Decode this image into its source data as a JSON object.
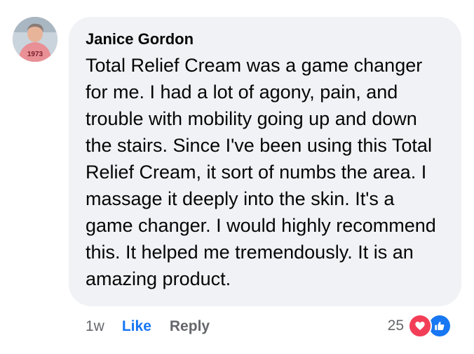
{
  "comment": {
    "author": "Janice Gordon",
    "avatar_text": "1973",
    "text": "Total Relief Cream was a game changer for me. I had a lot of agony, pain, and trouble with mobility going up and down the stairs. Since I've been using this Total Relief Cream, it sort of numbs the area. I massage it deeply into the skin. It's a game changer. I would highly recommend this. It helped me tremendously. It is an amazing product.",
    "time": "1w",
    "like_label": "Like",
    "reply_label": "Reply",
    "reaction_count": "25",
    "reactions": [
      "love-icon",
      "like-icon"
    ]
  },
  "colors": {
    "bubble": "#f0f2f5",
    "like_link": "#1877f2",
    "muted": "#65676b",
    "love": "#f33e58",
    "like": "#1877f2"
  }
}
